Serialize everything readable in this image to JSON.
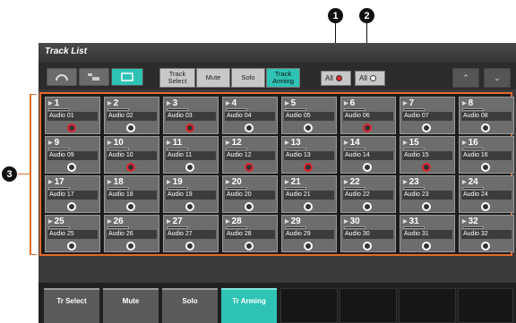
{
  "callouts": [
    "1",
    "2",
    "3"
  ],
  "window": {
    "title": "Track List"
  },
  "toolbar": {
    "view_buttons": [
      {
        "icon": "headphones-icon",
        "active": false
      },
      {
        "icon": "folder-tracks-icon",
        "active": false
      },
      {
        "icon": "track-list-icon",
        "active": true
      }
    ],
    "modes": [
      {
        "label": "Track Select",
        "active": false
      },
      {
        "label": "Mute",
        "active": false
      },
      {
        "label": "Solo",
        "active": false
      },
      {
        "label": "Track Arming",
        "active": true
      }
    ],
    "all_rec": {
      "label": "All",
      "state": "on"
    },
    "all_off": {
      "label": "All",
      "state": "off"
    },
    "nav": [
      {
        "icon": "chevron-up-icon"
      },
      {
        "icon": "chevron-down-icon"
      }
    ]
  },
  "tracks": [
    {
      "num": "1",
      "name": "Audio 01",
      "armed": true
    },
    {
      "num": "2",
      "name": "Audio 02",
      "armed": false
    },
    {
      "num": "3",
      "name": "Audio 03",
      "armed": true
    },
    {
      "num": "4",
      "name": "Audio 04",
      "armed": false
    },
    {
      "num": "5",
      "name": "Audio 05",
      "armed": false
    },
    {
      "num": "6",
      "name": "Audio 06",
      "armed": true
    },
    {
      "num": "7",
      "name": "Audio 07",
      "armed": false
    },
    {
      "num": "8",
      "name": "Audio 08",
      "armed": false
    },
    {
      "num": "9",
      "name": "Audio 09",
      "armed": false
    },
    {
      "num": "10",
      "name": "Audio 10",
      "armed": true
    },
    {
      "num": "11",
      "name": "Audio 11",
      "armed": false
    },
    {
      "num": "12",
      "name": "Audio 12",
      "armed": true
    },
    {
      "num": "13",
      "name": "Audio 13",
      "armed": true
    },
    {
      "num": "14",
      "name": "Audio 14",
      "armed": false
    },
    {
      "num": "15",
      "name": "Audio 15",
      "armed": true
    },
    {
      "num": "16",
      "name": "Audio 16",
      "armed": false
    },
    {
      "num": "17",
      "name": "Audio 17",
      "armed": false
    },
    {
      "num": "18",
      "name": "Audio 18",
      "armed": false
    },
    {
      "num": "19",
      "name": "Audio 19",
      "armed": false
    },
    {
      "num": "20",
      "name": "Audio 20",
      "armed": false
    },
    {
      "num": "21",
      "name": "Audio 21",
      "armed": false
    },
    {
      "num": "22",
      "name": "Audio 22",
      "armed": false
    },
    {
      "num": "23",
      "name": "Audio 23",
      "armed": false
    },
    {
      "num": "24",
      "name": "Audio 24",
      "armed": false
    },
    {
      "num": "25",
      "name": "Audio 25",
      "armed": false
    },
    {
      "num": "26",
      "name": "Audio 26",
      "armed": false
    },
    {
      "num": "27",
      "name": "Audio 27",
      "armed": false
    },
    {
      "num": "28",
      "name": "Audio 28",
      "armed": false
    },
    {
      "num": "29",
      "name": "Audio 29",
      "armed": false
    },
    {
      "num": "30",
      "name": "Audio 30",
      "armed": false
    },
    {
      "num": "31",
      "name": "Audio 31",
      "armed": false
    },
    {
      "num": "32",
      "name": "Audio 32",
      "armed": false
    }
  ],
  "bottom_buttons": [
    {
      "label": "Tr Select",
      "active": false
    },
    {
      "label": "Mute",
      "active": false
    },
    {
      "label": "Solo",
      "active": false
    },
    {
      "label": "Tr Arming",
      "active": true
    }
  ],
  "colors": {
    "accent": "#2ec3b4",
    "rec": "#e0262d",
    "highlight": "#e36b2a"
  }
}
